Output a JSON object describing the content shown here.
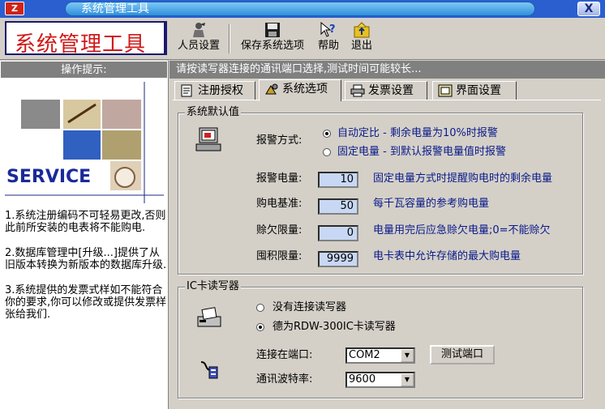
{
  "window": {
    "title": "系统管理工具",
    "close_label": "X",
    "app_icon_label": "Z"
  },
  "toolbar": {
    "logo_text": "系统管理工具",
    "buttons": [
      {
        "label": "人员设置",
        "icon": "people-icon"
      },
      {
        "label": "保存系统选项",
        "icon": "save-icon"
      },
      {
        "label": "帮助",
        "icon": "help-icon"
      },
      {
        "label": "退出",
        "icon": "exit-icon"
      }
    ]
  },
  "left_panel": {
    "header": "操作提示:",
    "banner_text": "SERVICE",
    "hints": [
      "1.系统注册编码不可轻易更改,否则此前所安装的电表将不能购电.",
      "2.数据库管理中[升级...]提供了从旧版本转换为新版本的数据库升级.",
      "3.系统提供的发票式样如不能符合你的要求,你可以修改或提供发票样张给我们."
    ]
  },
  "status_message": "请按读写器连接的通讯端口选择,测试时间可能较长...",
  "tabs": [
    {
      "label": "注册授权",
      "icon": "register-icon",
      "active": false
    },
    {
      "label": "系统选项",
      "icon": "options-icon",
      "active": true
    },
    {
      "label": "发票设置",
      "icon": "printer-icon",
      "active": false
    },
    {
      "label": "界面设置",
      "icon": "interface-icon",
      "active": false
    }
  ],
  "defaults_group": {
    "title": "系统默认值",
    "alarm_mode_label": "报警方式:",
    "alarm_options": [
      {
        "label": "自动定比 - 剩余电量为10%时报警",
        "selected": true
      },
      {
        "label": "固定电量 - 到默认报警电量值时报警",
        "selected": false
      }
    ],
    "fields": [
      {
        "label": "报警电量:",
        "value": "10",
        "desc": "固定电量方式时提醒购电时的剩余电量"
      },
      {
        "label": "购电基准:",
        "value": "50",
        "desc": "每千瓦容量的参考购电量"
      },
      {
        "label": "赊欠限量:",
        "value": "0",
        "desc": "电量用完后应急赊欠电量;0=不能赊欠"
      },
      {
        "label": "囤积限量:",
        "value": "9999",
        "desc": "电卡表中允许存储的最大购电量"
      }
    ]
  },
  "reader_group": {
    "title": "IC卡读写器",
    "reader_options": [
      {
        "label": "没有连接读写器",
        "selected": false
      },
      {
        "label": "德为RDW-300IC卡读写器",
        "selected": true
      }
    ],
    "port_label": "连接在端口:",
    "port_value": "COM2",
    "test_button": "测试端口",
    "baud_label": "通讯波特率:",
    "baud_value": "9600"
  },
  "colors": {
    "title_blue": "#2b5fd0",
    "logo_red": "#d01818",
    "desc_blue": "#0a1a8a",
    "field_bg": "#c8d8f4",
    "panel_gray": "#d4d0c8"
  }
}
